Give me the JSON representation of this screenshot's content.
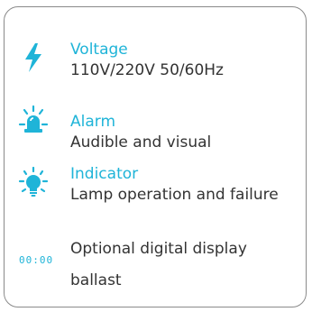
{
  "accent_color": "#1fb4d8",
  "text_color": "#333333",
  "features": [
    {
      "icon": "lightning-icon",
      "title": "Voltage",
      "description": "110V/220V 50/60Hz"
    },
    {
      "icon": "alarm-siren-icon",
      "title": "Alarm",
      "description": "Audible and visual"
    },
    {
      "icon": "light-bulb-icon",
      "title": "Indicator",
      "description": "Lamp operation and failure"
    }
  ],
  "optional": {
    "icon": "digital-display-icon",
    "display_text": "00:00",
    "line1": "Optional digital display",
    "line2": "ballast"
  }
}
